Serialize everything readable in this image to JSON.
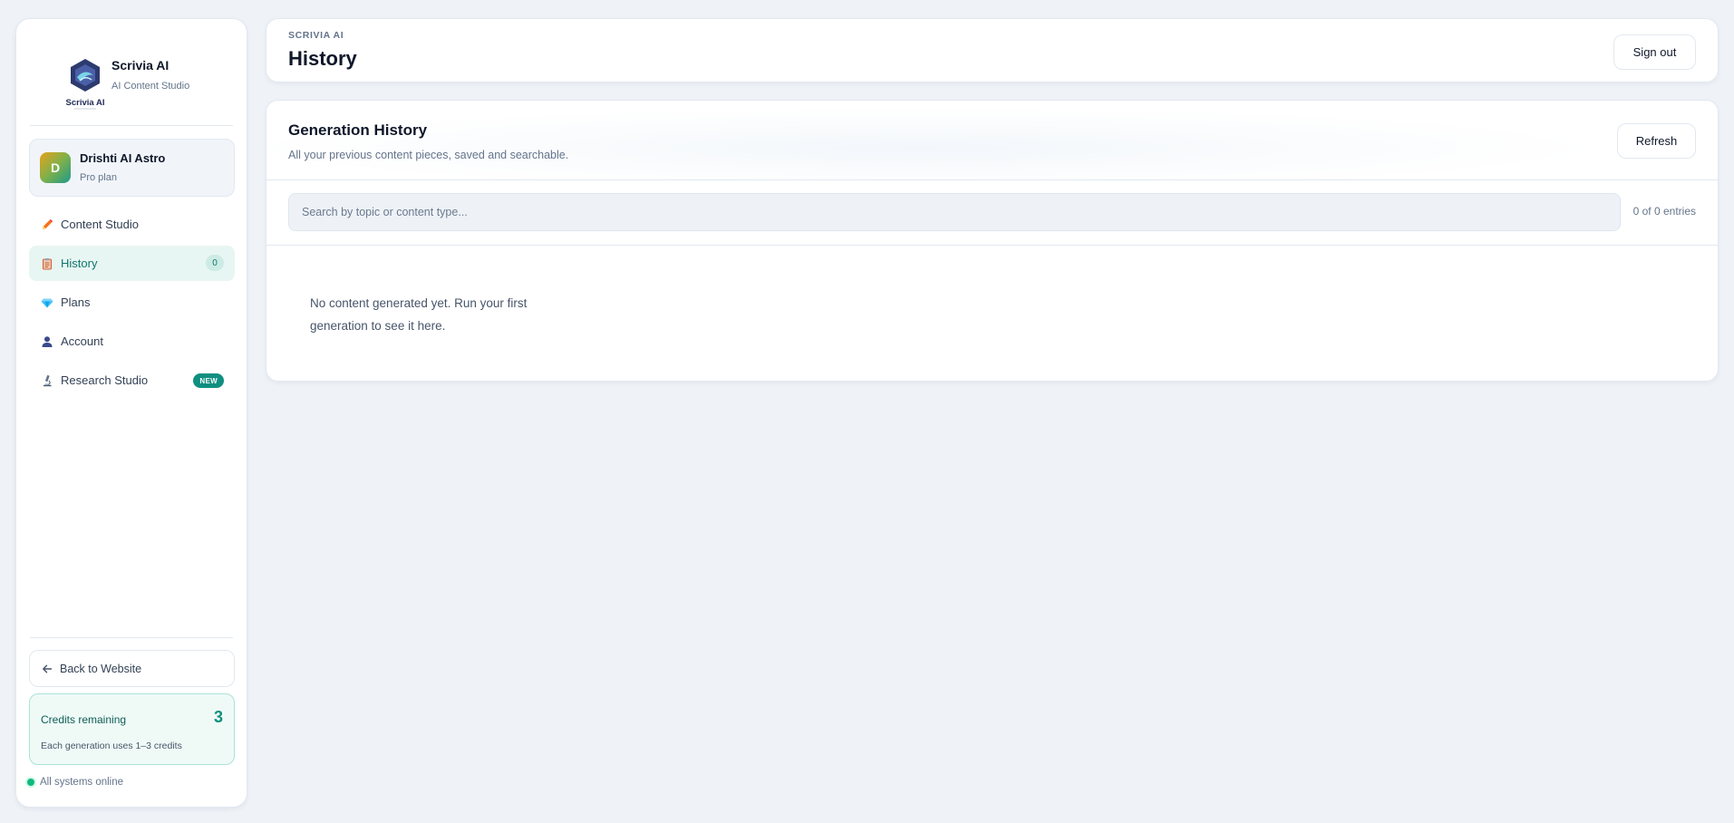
{
  "brand": {
    "logo_text": "Scrivia AI",
    "name": "Scrivia AI",
    "subtitle": "AI Content Studio"
  },
  "user": {
    "initial": "D",
    "name": "Drishti AI Astro",
    "plan": "Pro plan"
  },
  "nav": [
    {
      "label": "Content Studio",
      "icon": "pencil-icon"
    },
    {
      "label": "History",
      "icon": "clipboard-icon",
      "active": true,
      "count": "0"
    },
    {
      "label": "Plans",
      "icon": "diamond-icon"
    },
    {
      "label": "Account",
      "icon": "user-icon"
    },
    {
      "label": "Research Studio",
      "icon": "microscope-icon",
      "badge": "NEW"
    }
  ],
  "back_link": {
    "label": "Back to Website",
    "icon": "arrow-left-icon"
  },
  "credits": {
    "title": "Credits remaining",
    "value": "3",
    "note": "Each generation uses 1–3 credits"
  },
  "status": {
    "label": "All systems online",
    "color": "#10b981"
  },
  "header": {
    "eyebrow": "SCRIVIA AI",
    "title": "History",
    "signout_label": "Sign out"
  },
  "panel": {
    "title": "Generation History",
    "subtitle": "All your previous content pieces, saved and searchable.",
    "refresh_label": "Refresh",
    "search_placeholder": "Search by topic or content type...",
    "search_value": "",
    "entries_text": "0 of 0 entries",
    "empty_text": "No content generated yet. Run your first generation to see it here."
  },
  "colors": {
    "accent": "#0f8f80",
    "accent_dark": "#0f766e",
    "background": "#eff3f8"
  }
}
